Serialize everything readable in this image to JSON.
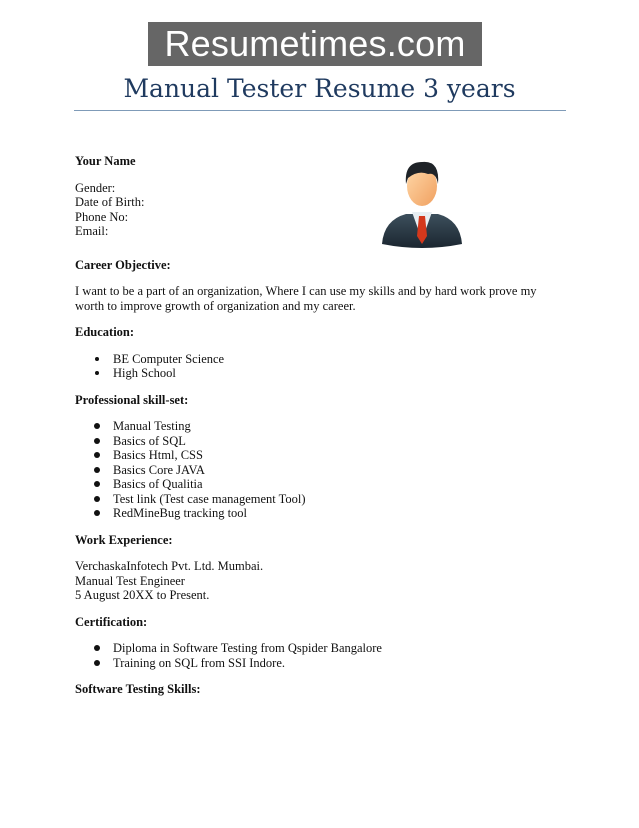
{
  "banner": {
    "text": "Resumetimes.com"
  },
  "title": "Manual Tester Resume 3 years",
  "personal": {
    "name": "Your Name",
    "fields": [
      "Gender:",
      "Date of Birth:",
      "Phone No:",
      "Email:"
    ],
    "avatar_icon": "businessman-avatar-icon"
  },
  "career_objective": {
    "heading": "Career Objective:",
    "lines": [
      "I want to be a part of an organization, Where I can use my skills and by hard work prove my",
      "worth to improve growth of organization and my career."
    ]
  },
  "education": {
    "heading": "Education:",
    "items": [
      "BE Computer Science",
      "High School"
    ]
  },
  "skills": {
    "heading": "Professional skill-set:",
    "items": [
      "Manual Testing",
      "Basics of SQL",
      "Basics Html, CSS",
      "Basics Core JAVA",
      "Basics of Qualitia",
      "Test link (Test case management Tool)",
      "RedMineBug tracking tool"
    ]
  },
  "work": {
    "heading": "Work Experience:",
    "lines": [
      "VerchaskaInfotech Pvt. Ltd. Mumbai.",
      "Manual Test Engineer",
      "5 August 20XX to Present."
    ]
  },
  "certification": {
    "heading": "Certification:",
    "items": [
      "Diploma in Software Testing from Qspider Bangalore",
      "Training on SQL from SSI Indore."
    ]
  },
  "software_testing": {
    "heading": "Software Testing Skills:"
  }
}
